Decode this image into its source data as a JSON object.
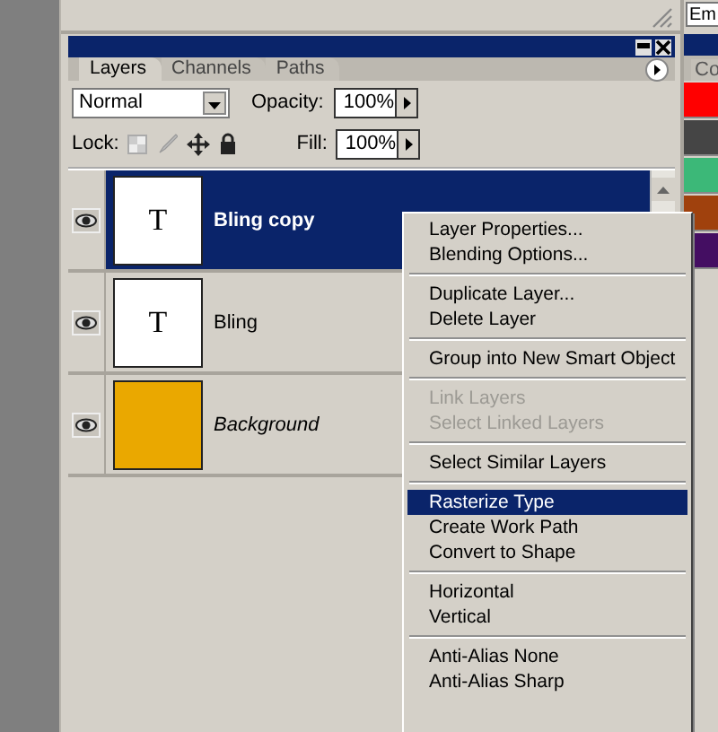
{
  "right_panel": {
    "field_value": "Em",
    "tab": "Co",
    "swatches": [
      {
        "color": "#ff0000"
      },
      {
        "color": "#454545"
      },
      {
        "color": "#3cb878"
      },
      {
        "color": "#a0410d"
      },
      {
        "color": "#440e62"
      }
    ]
  },
  "layers_panel": {
    "tabs": [
      {
        "label": "Layers",
        "selected": true
      },
      {
        "label": "Channels",
        "selected": false
      },
      {
        "label": "Paths",
        "selected": false
      }
    ],
    "blend_mode": "Normal",
    "opacity_label": "Opacity:",
    "opacity": "100%",
    "lock_label": "Lock:",
    "fill_label": "Fill:",
    "fill": "100%",
    "layers": [
      {
        "name": "Bling copy",
        "kind": "text",
        "thumb_glyph": "T",
        "visible": true,
        "selected": true,
        "italic": false
      },
      {
        "name": "Bling",
        "kind": "text",
        "thumb_glyph": "T",
        "visible": true,
        "selected": false,
        "italic": false
      },
      {
        "name": "Background",
        "kind": "fill",
        "color": "#eaa800",
        "visible": true,
        "selected": false,
        "italic": true
      }
    ]
  },
  "context_menu": {
    "groups": [
      [
        {
          "label": "Layer Properties...",
          "disabled": false,
          "selected": false
        },
        {
          "label": "Blending Options...",
          "disabled": false,
          "selected": false
        }
      ],
      [
        {
          "label": "Duplicate Layer...",
          "disabled": false,
          "selected": false
        },
        {
          "label": "Delete Layer",
          "disabled": false,
          "selected": false
        }
      ],
      [
        {
          "label": "Group into New Smart Object",
          "disabled": false,
          "selected": false
        }
      ],
      [
        {
          "label": "Link Layers",
          "disabled": true,
          "selected": false
        },
        {
          "label": "Select Linked Layers",
          "disabled": true,
          "selected": false
        }
      ],
      [
        {
          "label": "Select Similar Layers",
          "disabled": false,
          "selected": false
        }
      ],
      [
        {
          "label": "Rasterize Type",
          "disabled": false,
          "selected": true
        },
        {
          "label": "Create Work Path",
          "disabled": false,
          "selected": false
        },
        {
          "label": "Convert to Shape",
          "disabled": false,
          "selected": false
        }
      ],
      [
        {
          "label": "Horizontal",
          "disabled": false,
          "selected": false
        },
        {
          "label": "Vertical",
          "disabled": false,
          "selected": false
        }
      ],
      [
        {
          "label": "Anti-Alias None",
          "disabled": false,
          "selected": false
        },
        {
          "label": "Anti-Alias Sharp",
          "disabled": false,
          "selected": false
        }
      ]
    ]
  }
}
